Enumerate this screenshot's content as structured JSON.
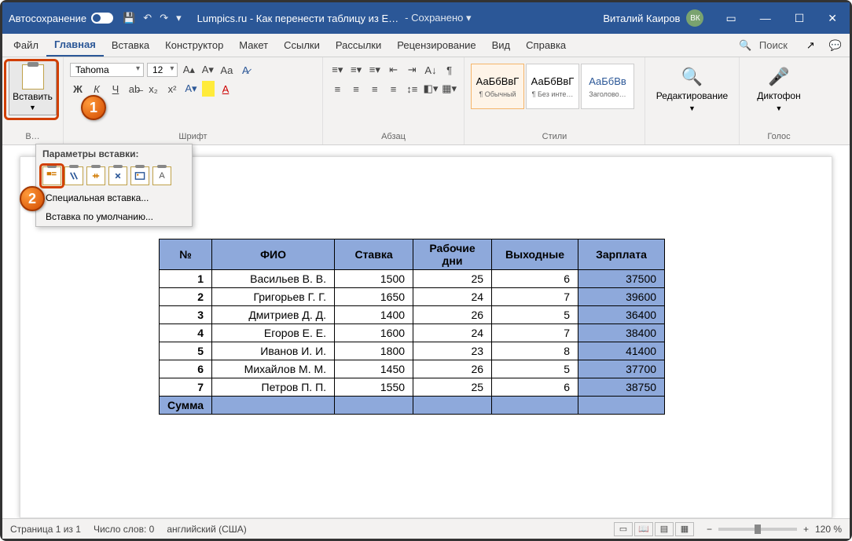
{
  "titlebar": {
    "autosave": "Автосохранение",
    "doctitle": "Lumpics.ru - Как перенести таблицу из E…",
    "saved": "- Сохранено ▾",
    "username": "Виталий Каиров",
    "initials": "ВК"
  },
  "tabs": {
    "file": "Файл",
    "home": "Главная",
    "insert": "Вставка",
    "design": "Конструктор",
    "layout": "Макет",
    "references": "Ссылки",
    "mailings": "Рассылки",
    "review": "Рецензирование",
    "view": "Вид",
    "help": "Справка",
    "search": "Поиск"
  },
  "ribbon": {
    "paste": "Вставить",
    "clipboard_label": "В…",
    "font_name": "Tahoma",
    "font_size": "12",
    "font_label": "Шрифт",
    "para_label": "Абзац",
    "style1_sample": "АаБбВвГ",
    "style1_lbl": "¶ Обычный",
    "style2_sample": "АаБбВвГ",
    "style2_lbl": "¶ Без инте…",
    "style3_sample": "АаБбВв",
    "style3_lbl": "Заголово…",
    "styles_label": "Стили",
    "editing": "Редактирование",
    "dictate": "Диктофон",
    "voice_label": "Голос"
  },
  "paste_dd": {
    "header": "Параметры вставки:",
    "special": "Специальная вставка...",
    "default": "Вставка по умолчанию..."
  },
  "table": {
    "headers": {
      "num": "№",
      "fio": "ФИО",
      "rate": "Ставка",
      "days": "Рабочие дни",
      "off": "Выходные",
      "salary": "Зарплата"
    },
    "rows": [
      {
        "n": "1",
        "fio": "Васильев В. В.",
        "rate": "1500",
        "days": "25",
        "off": "6",
        "sal": "37500"
      },
      {
        "n": "2",
        "fio": "Григорьев Г. Г.",
        "rate": "1650",
        "days": "24",
        "off": "7",
        "sal": "39600"
      },
      {
        "n": "3",
        "fio": "Дмитриев Д. Д.",
        "rate": "1400",
        "days": "26",
        "off": "5",
        "sal": "36400"
      },
      {
        "n": "4",
        "fio": "Егоров Е. Е.",
        "rate": "1600",
        "days": "24",
        "off": "7",
        "sal": "38400"
      },
      {
        "n": "5",
        "fio": "Иванов И. И.",
        "rate": "1800",
        "days": "23",
        "off": "8",
        "sal": "41400"
      },
      {
        "n": "6",
        "fio": "Михайлов М. М.",
        "rate": "1450",
        "days": "26",
        "off": "5",
        "sal": "37700"
      },
      {
        "n": "7",
        "fio": "Петров П. П.",
        "rate": "1550",
        "days": "25",
        "off": "6",
        "sal": "38750"
      }
    ],
    "sum": "Сумма"
  },
  "status": {
    "page": "Страница 1 из 1",
    "words": "Число слов: 0",
    "lang": "английский (США)",
    "zoom": "120 %"
  },
  "badges": {
    "one": "1",
    "two": "2"
  }
}
